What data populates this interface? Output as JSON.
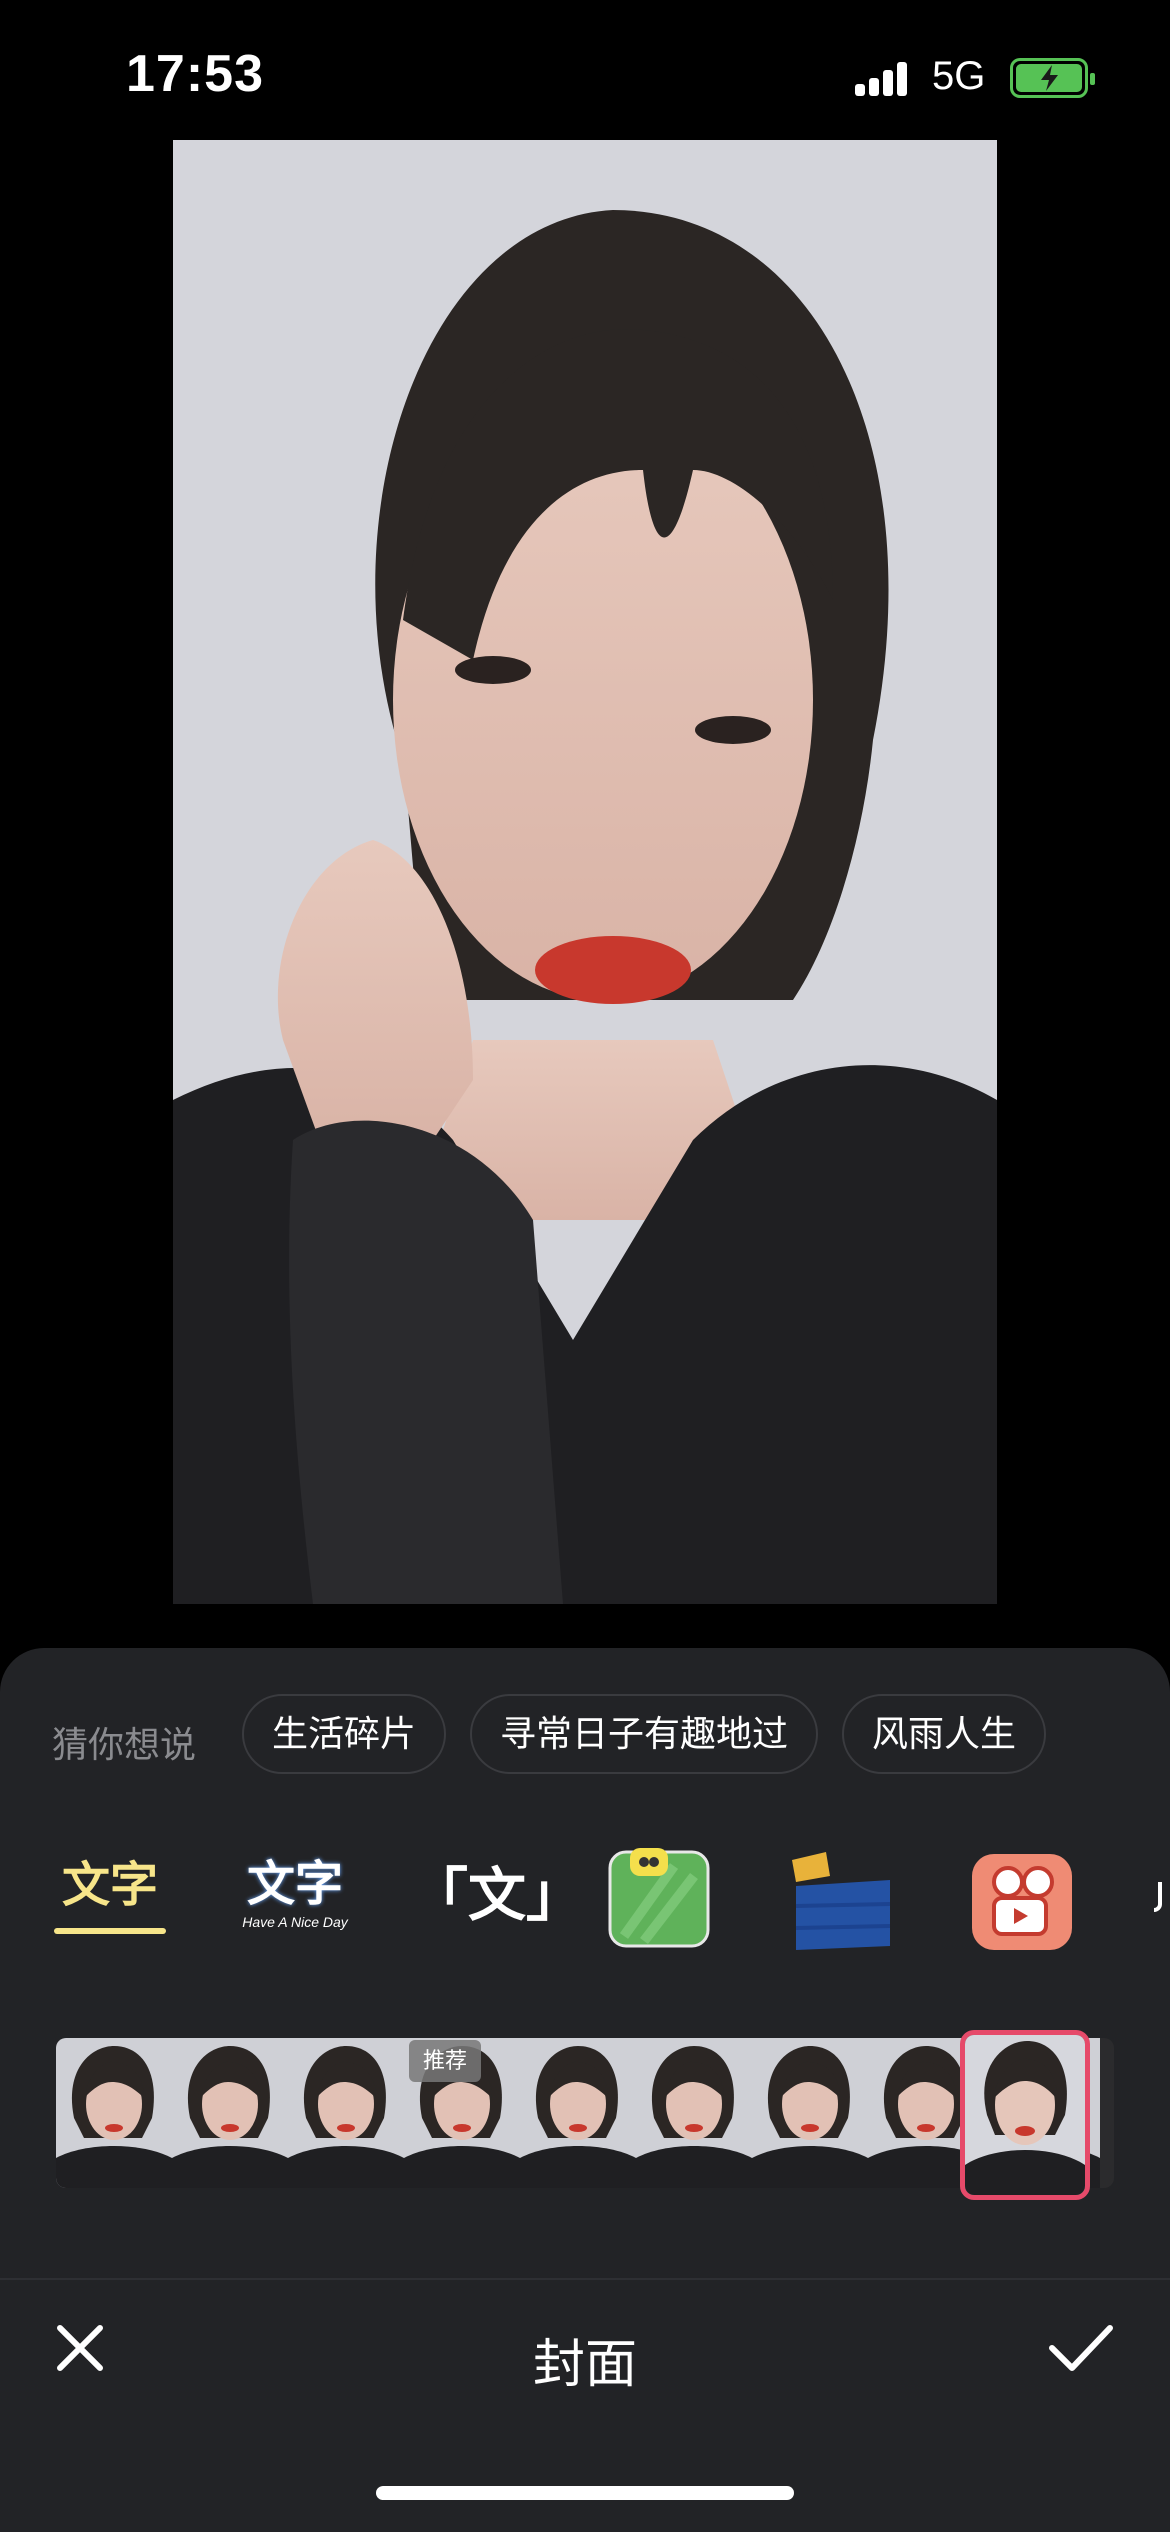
{
  "status_bar": {
    "time": "17:53",
    "network": "5G",
    "battery_icon": "battery-charging-icon"
  },
  "preview": {
    "subject": "selfie-photo"
  },
  "suggestions": {
    "label": "猜你想说",
    "chips": [
      "生活碎片",
      "寻常日子有趣地过",
      "风雨人生"
    ]
  },
  "text_styles": {
    "style1": "文字",
    "style2_main": "文字",
    "style2_sub": "Have A Nice Day",
    "style3": "「文」",
    "style4_icon": "green-sticker-icon",
    "style5_icon": "blue-banner-sticker-icon",
    "style6_icon": "video-camera-sticker-icon"
  },
  "filmstrip": {
    "badge": "推荐"
  },
  "toolbar": {
    "title": "封面",
    "close_icon": "close-icon",
    "confirm_icon": "checkmark-icon"
  },
  "colors": {
    "accent": "#e64a6a",
    "sheet_bg": "#222326",
    "style_yellow": "#f7e58a"
  }
}
